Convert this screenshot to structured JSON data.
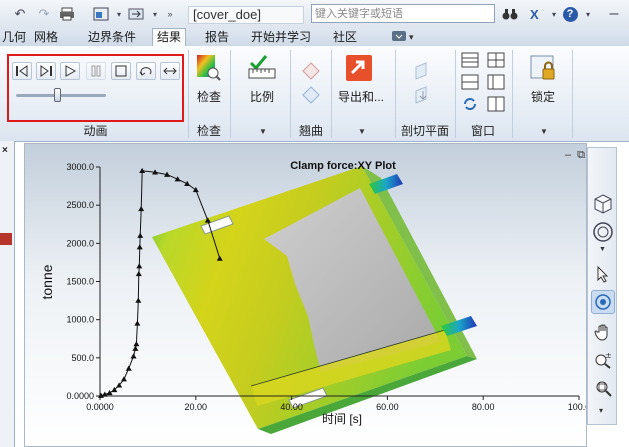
{
  "app": {
    "document_title": "[cover_doe]",
    "search_placeholder": "键入关键字或短语",
    "help_label": "?"
  },
  "tabs": [
    {
      "label": "几何",
      "active": false
    },
    {
      "label": "网格",
      "active": false
    },
    {
      "label": "边界条件",
      "active": false
    },
    {
      "label": "结果",
      "active": true
    },
    {
      "label": "报告",
      "active": false
    },
    {
      "label": "开始并学习",
      "active": false
    },
    {
      "label": "社区",
      "active": false
    }
  ],
  "ribbon": {
    "groups": {
      "animation": "动画",
      "check": "检查",
      "overmold": "翘曲",
      "clip_plane": "剖切平面",
      "window": "窗口"
    },
    "buttons": {
      "check": "检查",
      "scale": "比例",
      "export": "导出和...",
      "lock": "锁定"
    },
    "animation_slider_value": 0.45
  },
  "plot": {
    "title": "Clamp force:XY Plot",
    "xlabel": "时间 [s]",
    "ylabel": "tonne"
  },
  "chart_data": {
    "type": "line",
    "title": "Clamp force:XY Plot",
    "xlabel": "时间 [s]",
    "ylabel": "tonne",
    "xlim": [
      0,
      100
    ],
    "ylim": [
      0,
      3000
    ],
    "x_ticks": [
      "0.0000",
      "20.00",
      "40.00",
      "60.00",
      "80.00",
      "100.0"
    ],
    "y_ticks": [
      "0.0000",
      "500.0",
      "1000.0",
      "1500.0",
      "2000.0",
      "2500.0",
      "3000.0"
    ],
    "series": [
      {
        "x": [
          0.2,
          1.0,
          2.0,
          3.0,
          4.0,
          5.0,
          6.0,
          7.0,
          7.4,
          7.6,
          7.8,
          8.0,
          8.1,
          8.2,
          8.3,
          8.4,
          8.6,
          8.8,
          11.5,
          14.0,
          16.2,
          18.2,
          20.0,
          22.5,
          25.0
        ],
        "y": [
          5,
          20,
          40,
          80,
          140,
          220,
          360,
          520,
          620,
          680,
          950,
          1250,
          1600,
          1700,
          1950,
          2100,
          2450,
          2950,
          2930,
          2900,
          2840,
          2780,
          2700,
          2300,
          1800
        ]
      }
    ]
  },
  "viewbar": {
    "icons": [
      "view-cube-icon",
      "steering-wheel-icon",
      "select-arrow-icon",
      "rotate-icon",
      "pan-hand-icon",
      "zoom-realtime-icon",
      "zoom-window-icon"
    ]
  }
}
